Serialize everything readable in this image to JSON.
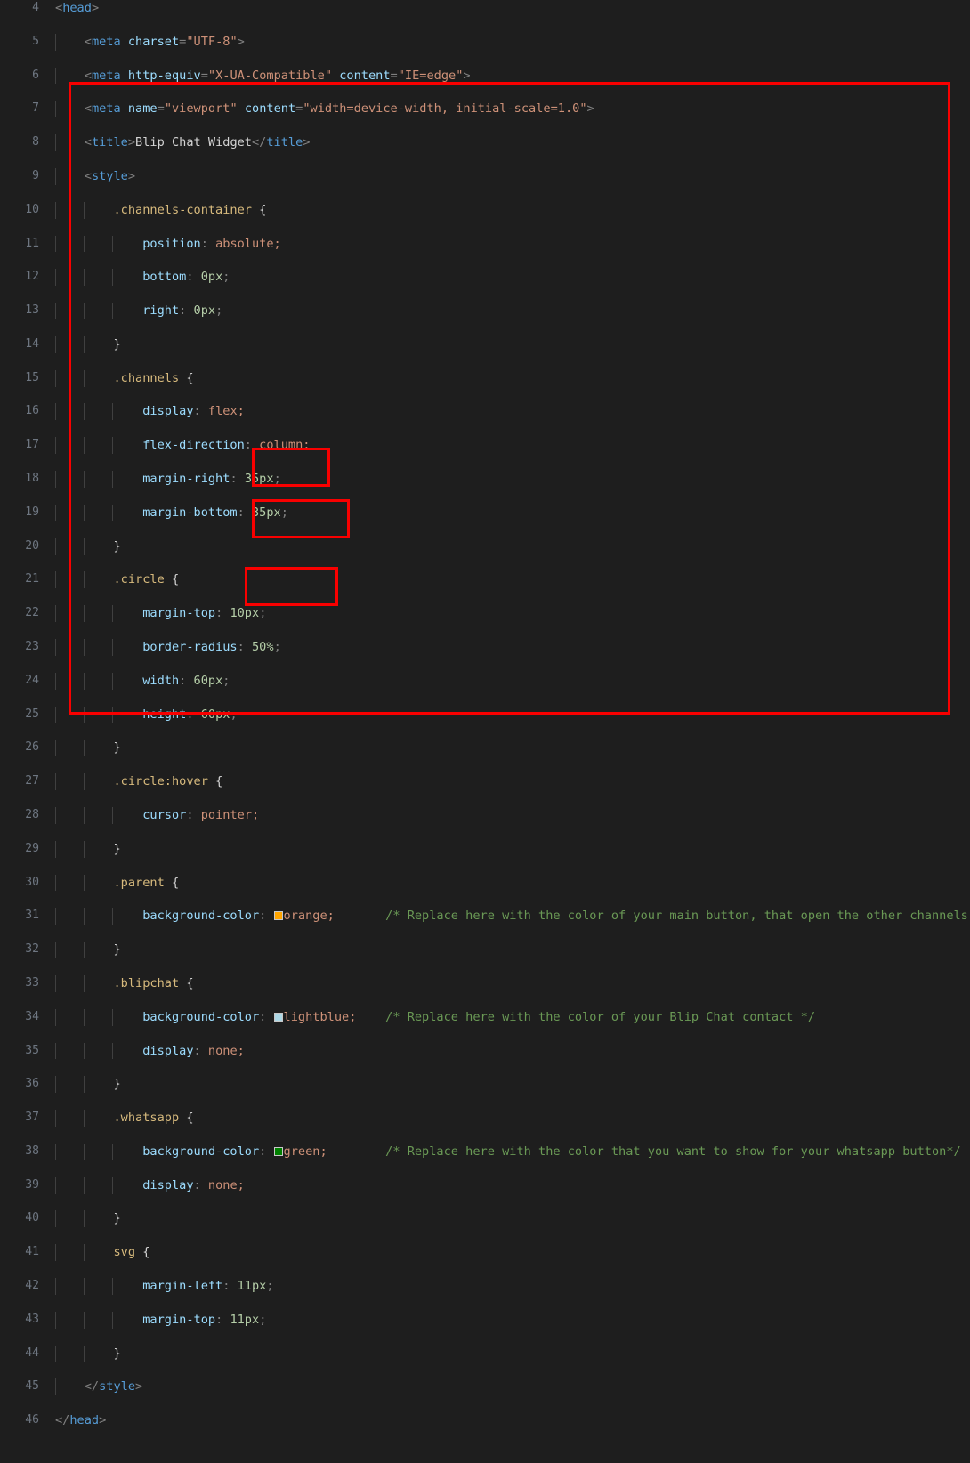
{
  "editor": {
    "name": "code-editor",
    "background_color": "#1e1e1e",
    "gutter_color": "#6e7681",
    "annotation_color": "#f90000",
    "first_line_number": 4,
    "last_line_number": 46
  },
  "annotations": {
    "style_block_box": "style-block-highlight",
    "parent_color_box": "parent-background-color-highlight",
    "blipchat_color_box": "blipchat-background-color-highlight",
    "whatsapp_color_box": "whatsapp-background-color-highlight"
  },
  "color_swatches": {
    "orange": "#ffa500",
    "lightblue": "#add8e6",
    "green": "#008000"
  },
  "lines": [
    {
      "n": "4",
      "indent": 0,
      "text": "<head>"
    },
    {
      "n": "5",
      "indent": 1,
      "text": "    <meta charset=\"UTF-8\">"
    },
    {
      "n": "6",
      "indent": 1,
      "text": "    <meta http-equiv=\"X-UA-Compatible\" content=\"IE=edge\">"
    },
    {
      "n": "7",
      "indent": 1,
      "text": "    <meta name=\"viewport\" content=\"width=device-width, initial-scale=1.0\">"
    },
    {
      "n": "8",
      "indent": 1,
      "text": "    <title>Blip Chat Widget</title>"
    },
    {
      "n": "9",
      "indent": 1,
      "text": "    <style>"
    },
    {
      "n": "10",
      "indent": 2,
      "text": "        .channels-container {"
    },
    {
      "n": "11",
      "indent": 3,
      "text": "            position: absolute;"
    },
    {
      "n": "12",
      "indent": 3,
      "text": "            bottom: 0px;"
    },
    {
      "n": "13",
      "indent": 3,
      "text": "            right: 0px;"
    },
    {
      "n": "14",
      "indent": 2,
      "text": "        }"
    },
    {
      "n": "15",
      "indent": 2,
      "text": "        .channels {"
    },
    {
      "n": "16",
      "indent": 3,
      "text": "            display: flex;"
    },
    {
      "n": "17",
      "indent": 3,
      "text": "            flex-direction: column;"
    },
    {
      "n": "18",
      "indent": 3,
      "text": "            margin-right: 35px;"
    },
    {
      "n": "19",
      "indent": 3,
      "text": "            margin-bottom: 35px;"
    },
    {
      "n": "20",
      "indent": 2,
      "text": "        }"
    },
    {
      "n": "21",
      "indent": 2,
      "text": "        .circle {"
    },
    {
      "n": "22",
      "indent": 3,
      "text": "            margin-top: 10px;"
    },
    {
      "n": "23",
      "indent": 3,
      "text": "            border-radius: 50%;"
    },
    {
      "n": "24",
      "indent": 3,
      "text": "            width: 60px;"
    },
    {
      "n": "25",
      "indent": 3,
      "text": "            height: 60px;"
    },
    {
      "n": "26",
      "indent": 2,
      "text": "        }"
    },
    {
      "n": "27",
      "indent": 2,
      "text": "        .circle:hover {"
    },
    {
      "n": "28",
      "indent": 3,
      "text": "            cursor: pointer;"
    },
    {
      "n": "29",
      "indent": 2,
      "text": "        }"
    },
    {
      "n": "30",
      "indent": 2,
      "text": "        .parent {"
    },
    {
      "n": "31",
      "indent": 3,
      "text": "            background-color: orange;"
    },
    {
      "n": "32",
      "indent": 2,
      "text": "        }"
    },
    {
      "n": "33",
      "indent": 2,
      "text": "        .blipchat {"
    },
    {
      "n": "34",
      "indent": 3,
      "text": "            background-color: lightblue;"
    },
    {
      "n": "35",
      "indent": 3,
      "text": "            display: none;"
    },
    {
      "n": "36",
      "indent": 2,
      "text": "        }"
    },
    {
      "n": "37",
      "indent": 2,
      "text": "        .whatsapp {"
    },
    {
      "n": "38",
      "indent": 3,
      "text": "            background-color: green;"
    },
    {
      "n": "39",
      "indent": 3,
      "text": "            display: none;"
    },
    {
      "n": "40",
      "indent": 2,
      "text": "        }"
    },
    {
      "n": "41",
      "indent": 2,
      "text": "        svg {"
    },
    {
      "n": "42",
      "indent": 3,
      "text": "            margin-left: 11px;"
    },
    {
      "n": "43",
      "indent": 3,
      "text": "            margin-top: 11px;"
    },
    {
      "n": "44",
      "indent": 2,
      "text": "        }"
    },
    {
      "n": "45",
      "indent": 1,
      "text": "    </style>"
    },
    {
      "n": "46",
      "indent": 0,
      "text": "</head>"
    }
  ],
  "comments": {
    "parent": "/* Replace here with the color of your main button, that open the other channels */",
    "blipchat": "/* Replace here with the color of your Blip Chat contact */",
    "whatsapp": "/* Replace here with the color that you want to show for your whatsapp button*/"
  },
  "values": {
    "orange": "orange;",
    "lightblue": "lightblue;",
    "green": "green;"
  },
  "line_numbers": {
    "l4": "4",
    "l5": "5",
    "l6": "6",
    "l7": "7",
    "l8": "8",
    "l9": "9",
    "l10": "10",
    "l11": "11",
    "l12": "12",
    "l13": "13",
    "l14": "14",
    "l15": "15",
    "l16": "16",
    "l17": "17",
    "l18": "18",
    "l19": "19",
    "l20": "20",
    "l21": "21",
    "l22": "22",
    "l23": "23",
    "l24": "24",
    "l25": "25",
    "l26": "26",
    "l27": "27",
    "l28": "28",
    "l29": "29",
    "l30": "30",
    "l31": "31",
    "l32": "32",
    "l33": "33",
    "l34": "34",
    "l35": "35",
    "l36": "36",
    "l37": "37",
    "l38": "38",
    "l39": "39",
    "l40": "40",
    "l41": "41",
    "l42": "42",
    "l43": "43",
    "l44": "44",
    "l45": "45",
    "l46": "46"
  },
  "code_tokens": {
    "head_open": "<head>",
    "head_close": "</head>",
    "style_open": "<style>",
    "style_close": "</style>",
    "meta": "meta",
    "title": "title",
    "charset_attr": "charset",
    "charset_val": "\"UTF-8\"",
    "httpequiv_attr": "http-equiv",
    "httpequiv_val": "\"X-UA-Compatible\"",
    "content_attr": "content",
    "content_val_ie": "\"IE=edge\"",
    "name_attr": "name",
    "name_val": "\"viewport\"",
    "content_val_viewport": "\"width=device-width, initial-scale=1.0\"",
    "title_text": "Blip Chat Widget",
    "sel_channels_container": ".channels-container",
    "sel_channels": ".channels",
    "sel_circle": ".circle",
    "sel_circle_hover": ".circle:hover",
    "sel_parent": ".parent",
    "sel_blipchat": ".blipchat",
    "sel_whatsapp": ".whatsapp",
    "sel_svg": "svg",
    "p_position": "position",
    "p_bottom": "bottom",
    "p_right": "right",
    "p_display": "display",
    "p_flexdir": "flex-direction",
    "p_marginright": "margin-right",
    "p_marginbottom": "margin-bottom",
    "p_margintop": "margin-top",
    "p_marginleft": "margin-left",
    "p_borderradius": "border-radius",
    "p_width": "width",
    "p_height": "height",
    "p_cursor": "cursor",
    "p_bgcolor": "background-color",
    "v_absolute": "absolute;",
    "v_0px": "0px;",
    "v_flex": "flex;",
    "v_column": "column;",
    "v_35px": "35px;",
    "v_10px": "10px;",
    "v_50pct": "50%;",
    "v_60px": "60px;",
    "v_pointer": "pointer;",
    "v_none": "none;",
    "v_11px": "11px;"
  }
}
